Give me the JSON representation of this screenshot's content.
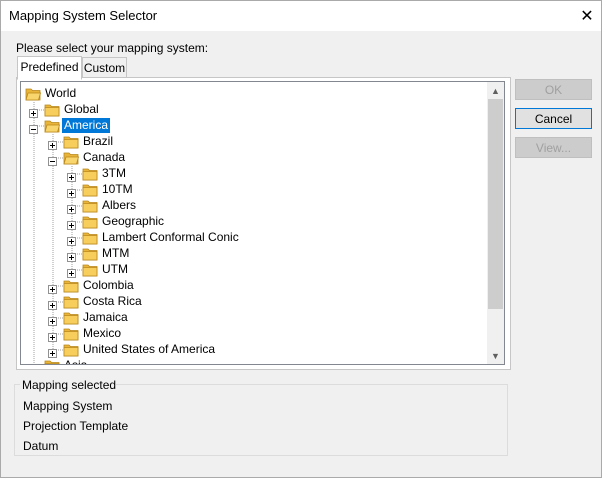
{
  "window": {
    "title": "Mapping System Selector"
  },
  "prompt": "Please select your mapping system:",
  "tabs": [
    {
      "label": "Predefined",
      "active": true
    },
    {
      "label": "Custom",
      "active": false
    }
  ],
  "tree": [
    {
      "label": "World",
      "level": 0,
      "expander": "none",
      "selected": false
    },
    {
      "label": "Global",
      "level": 1,
      "expander": "+",
      "selected": false
    },
    {
      "label": "America",
      "level": 1,
      "expander": "-",
      "selected": true
    },
    {
      "label": "Brazil",
      "level": 2,
      "expander": "+",
      "selected": false
    },
    {
      "label": "Canada",
      "level": 2,
      "expander": "-",
      "selected": false
    },
    {
      "label": "3TM",
      "level": 3,
      "expander": "+",
      "selected": false
    },
    {
      "label": "10TM",
      "level": 3,
      "expander": "+",
      "selected": false
    },
    {
      "label": "Albers",
      "level": 3,
      "expander": "+",
      "selected": false
    },
    {
      "label": "Geographic",
      "level": 3,
      "expander": "+",
      "selected": false
    },
    {
      "label": "Lambert Conformal Conic",
      "level": 3,
      "expander": "+",
      "selected": false
    },
    {
      "label": "MTM",
      "level": 3,
      "expander": "+",
      "selected": false
    },
    {
      "label": "UTM",
      "level": 3,
      "expander": "+",
      "selected": false
    },
    {
      "label": "Colombia",
      "level": 2,
      "expander": "+",
      "selected": false
    },
    {
      "label": "Costa Rica",
      "level": 2,
      "expander": "+",
      "selected": false
    },
    {
      "label": "Jamaica",
      "level": 2,
      "expander": "+",
      "selected": false
    },
    {
      "label": "Mexico",
      "level": 2,
      "expander": "+",
      "selected": false
    },
    {
      "label": "United States of America",
      "level": 2,
      "expander": "+",
      "selected": false
    },
    {
      "label": "Asia",
      "level": 1,
      "expander": "+",
      "selected": false
    }
  ],
  "buttons": {
    "ok": "OK",
    "cancel": "Cancel",
    "view": "View..."
  },
  "mapping_selected": {
    "title": "Mapping selected",
    "items": [
      "Mapping System",
      "Projection Template",
      "Datum"
    ]
  },
  "colors": {
    "selection": "#0078d7",
    "folder": "#f4c542"
  }
}
